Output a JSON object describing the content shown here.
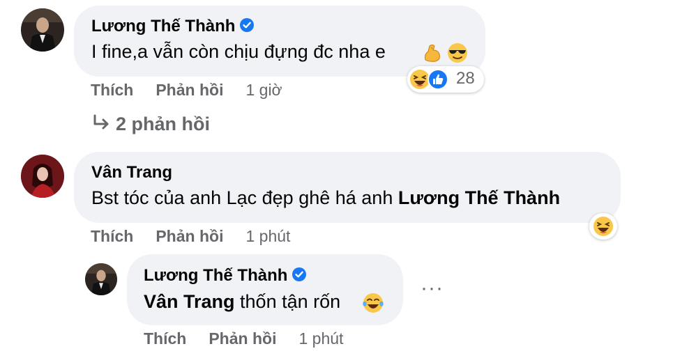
{
  "comments": [
    {
      "author": "Lương Thế Thành",
      "text": "I fine,a vẫn còn chịu đựng đc nha e",
      "like_label": "Thích",
      "reply_label": "Phản hồi",
      "time": "1 giờ",
      "reaction_count": "28",
      "reaction_icons": [
        "haha-emoji",
        "like-emoji"
      ],
      "inline_emojis": [
        "flexed-biceps-emoji",
        "sunglasses-emoji"
      ]
    },
    {
      "author": "Vân Trang",
      "text": "Bst tóc của anh Lạc đẹp ghê há anh ",
      "mention": "Lương Thế Thành",
      "like_label": "Thích",
      "reply_label": "Phản hồi",
      "time": "1 phút",
      "reaction_icons": [
        "haha-emoji"
      ]
    }
  ],
  "replies_link": "2 phản hồi",
  "reply": {
    "author": "Lương Thế Thành",
    "mention": "Vân Trang",
    "text": " thốn tận rốn",
    "like_label": "Thích",
    "reply_label": "Phản hồi",
    "time": "1 phút",
    "inline_emojis": [
      "tears-of-joy-emoji"
    ]
  },
  "more_button": "···",
  "colors": {
    "bubble": "#f0f2f5",
    "secondary_text": "#65676b",
    "verified_blue": "#1877f2"
  }
}
